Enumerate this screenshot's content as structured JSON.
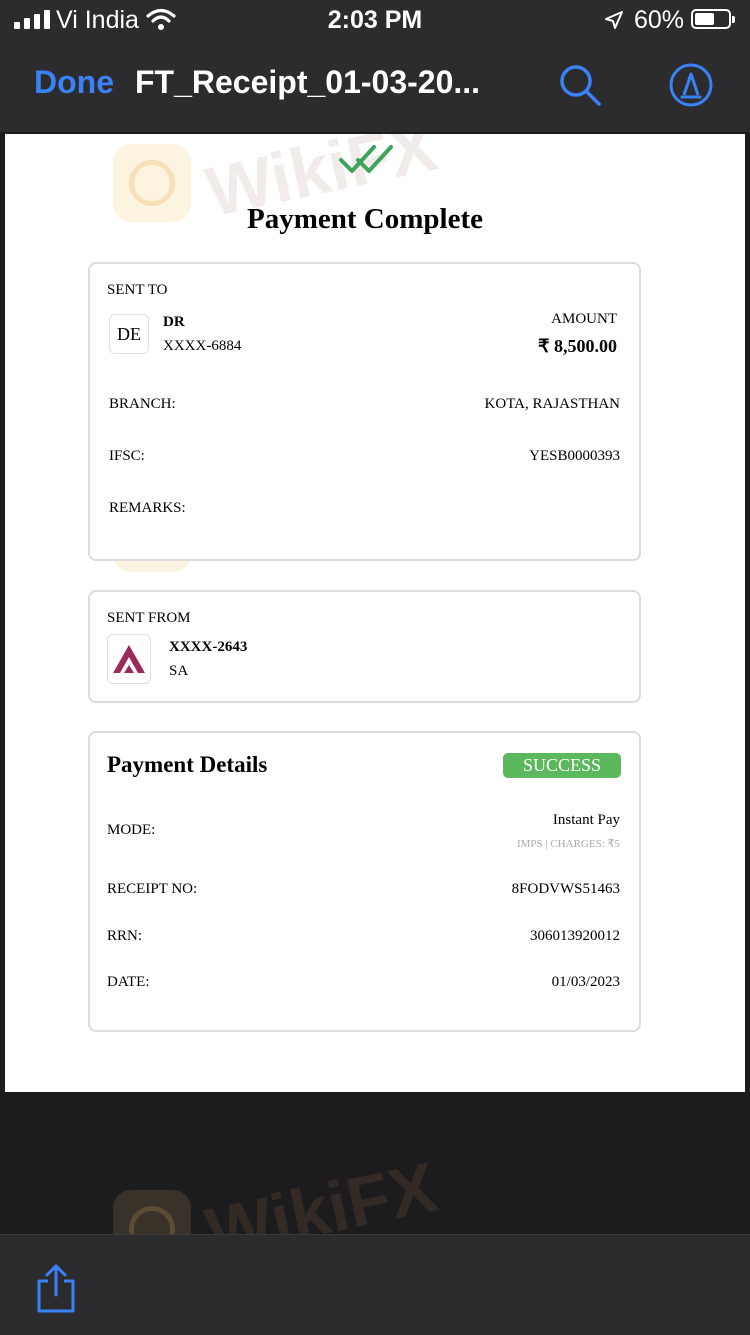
{
  "status_bar": {
    "carrier": "Vi India",
    "time": "2:03 PM",
    "battery": "60%",
    "battery_level": 0.6
  },
  "nav": {
    "done_label": "Done",
    "title": "FT_Receipt_01-03-20...",
    "accent_color": "#3a82f7"
  },
  "receipt": {
    "heading": "Payment Complete",
    "watermark": "WikiFX",
    "sent_to": {
      "label": "SENT TO",
      "initials": "DE",
      "name": "DR",
      "account": "XXXX-6884",
      "amount_label": "AMOUNT",
      "amount": "₹ 8,500.00",
      "branch_label": "BRANCH:",
      "branch": "KOTA, RAJASTHAN",
      "ifsc_label": "IFSC:",
      "ifsc": "YESB0000393",
      "remarks_label": "REMARKS:"
    },
    "sent_from": {
      "label": "SENT FROM",
      "account": "XXXX-2643",
      "name": "SA"
    },
    "details": {
      "title": "Payment Details",
      "status": "SUCCESS",
      "status_color": "#5cb85c",
      "mode_label": "MODE:",
      "mode": "Instant Pay",
      "mode_sub": "IMPS | CHARGES: ₹5",
      "receipt_label": "RECEIPT NO:",
      "receipt": "8FODVWS51463",
      "rrn_label": "RRN:",
      "rrn": "306013920012",
      "date_label": "DATE:",
      "date": "01/03/2023"
    }
  },
  "icons": {
    "search": "search-icon",
    "markup": "markup-pen-icon",
    "share": "share-icon"
  }
}
